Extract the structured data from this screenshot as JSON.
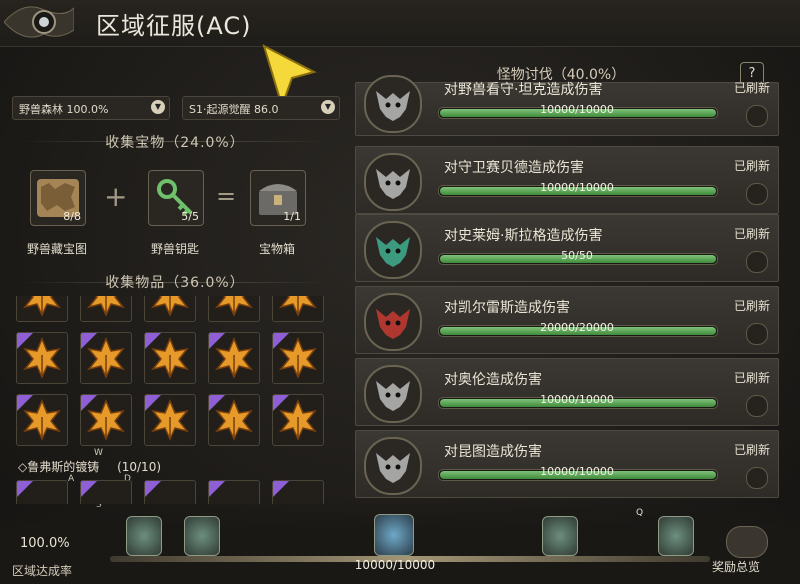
{
  "header": {
    "title": "区域征服(AC)"
  },
  "filters": [
    {
      "label": "野兽森林 100.0%"
    },
    {
      "label": "S1·起源觉醒 86.0"
    }
  ],
  "treasure": {
    "section_title": "收集宝物（24.0%）",
    "items": [
      {
        "name": "野兽藏宝图",
        "count": "8/8",
        "icon": "treasure-map-icon"
      },
      {
        "name": "野兽钥匙",
        "count": "5/5",
        "icon": "key-icon"
      },
      {
        "name": "宝物箱",
        "count": "1/1",
        "icon": "chest-icon"
      }
    ],
    "plus": "+",
    "equals": "="
  },
  "collect": {
    "section_title": "收集物品（36.0%）",
    "item_icon": "maple-leaf-icon",
    "set_label": "◇鲁弗斯的镀铸",
    "set_count": "(10/10)"
  },
  "hints": {
    "w": "W",
    "a": "A",
    "d": "D",
    "s": "S",
    "q": "Q"
  },
  "quests": {
    "title": "怪物讨伐（40.0%）",
    "help": "?",
    "items": [
      {
        "name": "对野兽看守·坦克造成伤害",
        "status": "已刷新",
        "value": "10000/10000",
        "progress": 1.0,
        "color": "#bbbbbb"
      },
      {
        "name": "对守卫赛贝德造成伤害",
        "status": "已刷新",
        "value": "10000/10000",
        "progress": 1.0,
        "color": "#bbbbbb"
      },
      {
        "name": "对史莱姆·斯拉格造成伤害",
        "status": "已刷新",
        "value": "50/50",
        "progress": 1.0,
        "color": "#3fae8e"
      },
      {
        "name": "对凯尔雷斯造成伤害",
        "status": "已刷新",
        "value": "20000/20000",
        "progress": 1.0,
        "color": "#c83a32"
      },
      {
        "name": "对奥伦造成伤害",
        "status": "已刷新",
        "value": "10000/10000",
        "progress": 1.0,
        "color": "#bbbbbb"
      },
      {
        "name": "对昆图造成伤害",
        "status": "已刷新",
        "value": "10000/10000",
        "progress": 1.0,
        "color": "#bbbbbb"
      }
    ]
  },
  "footer": {
    "rate": "100.0%",
    "rate_label": "区域达成率",
    "progress_value": "10000/10000",
    "reward_label": "奖励总览"
  }
}
